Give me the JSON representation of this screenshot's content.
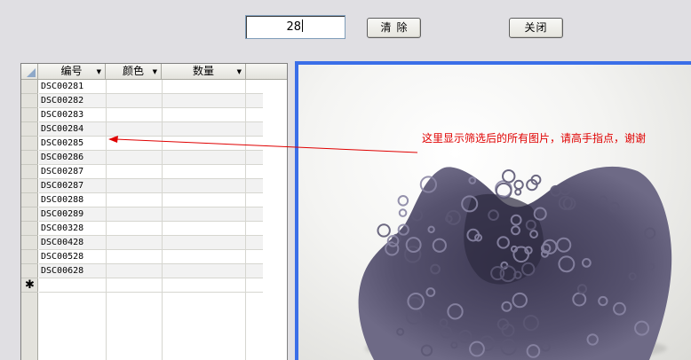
{
  "toolbar": {
    "filter_value": "28",
    "clear_label": "清除",
    "close_label": "关闭"
  },
  "grid": {
    "columns": [
      "编号",
      "颜色",
      "数量"
    ],
    "rows": [
      "DSC00281",
      "DSC00282",
      "DSC00283",
      "DSC00284",
      "DSC00285",
      "DSC00286",
      "DSC00287",
      "DSC00287",
      "DSC00288",
      "DSC00289",
      "DSC00328",
      "DSC00428",
      "DSC00528",
      "DSC00628"
    ],
    "new_row_marker": "✱"
  },
  "annotation": {
    "text": "这里显示筛选后的所有图片，请高手指点，谢谢",
    "color": "#e00000"
  },
  "colors": {
    "panel_border": "#3a6ee8",
    "yarn": "#4a4660"
  },
  "icons": {
    "dropdown": "chevron-down-icon",
    "new_record": "asterisk-icon",
    "arrow": "arrow-left-icon"
  }
}
